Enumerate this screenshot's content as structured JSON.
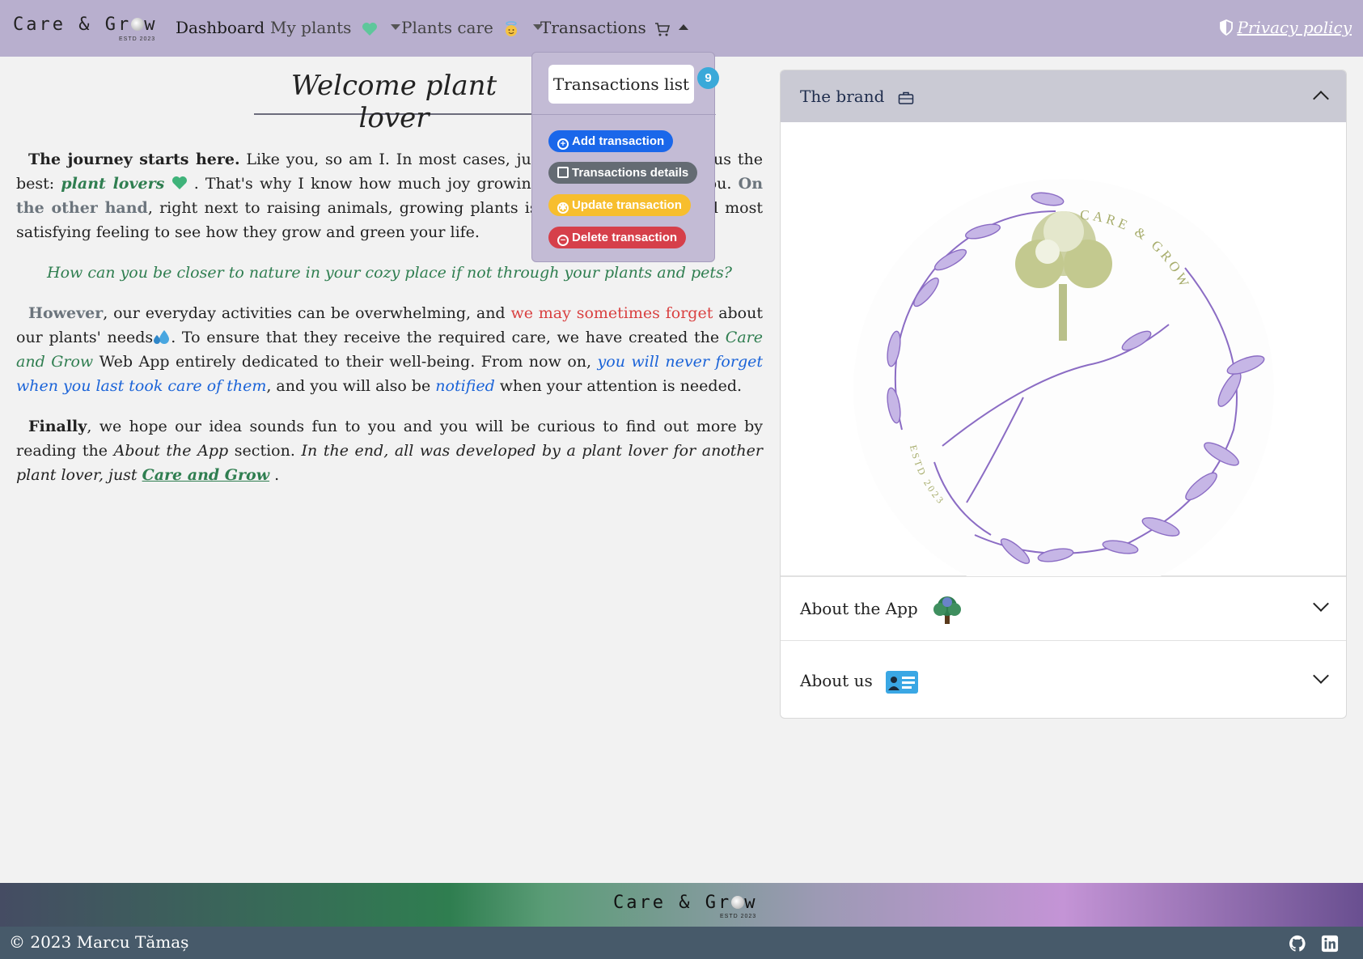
{
  "brand": {
    "name_part1": "Care & Gr",
    "name_part2": "w",
    "sub": "ESTD 2023"
  },
  "nav": {
    "dashboard": "Dashboard",
    "my_plants": "My plants",
    "plants_care": "Plants care",
    "transactions": "Transactions",
    "privacy": "Privacy policy"
  },
  "dropdown": {
    "list_label": "Transactions list",
    "badge": "9",
    "add": "Add transaction",
    "details": "Transactions details",
    "update": "Update transaction",
    "delete": "Delete transaction"
  },
  "main": {
    "welcome": "Welcome plant lover",
    "p1_bold": "The journey starts here.",
    "p1_a": " Like you, so am I. In most cases, just two words describe us the best: ",
    "p1_green": "plant lovers",
    "p1_b": " . That's why I know how much joy growing them can bring to you. ",
    "p1_grey": "On the other hand",
    "p1_c": ", right next to raising animals, growing plants is one of the purest and most satisfying feeling to see how they grow and green your life.",
    "quote": "How can you be closer to nature in your cozy place if not through your plants and pets?",
    "p2_grey": "However",
    "p2_a": ", our everyday activities can be overwhelming, and ",
    "p2_red": "we may sometimes forget",
    "p2_b": " about our plants' needs",
    "p2_c": ". To ensure that they receive the required care, we have created the ",
    "p2_green": "Care and Grow",
    "p2_d": " Web App entirely dedicated to their well-being. From now on, ",
    "p2_blue1": "you will never forget when you last took care of them",
    "p2_e": ", and you will also be ",
    "p2_blue2": "notified",
    "p2_f": " when your attention is needed.",
    "p3_bold": "Finally",
    "p3_a": ", we hope our idea sounds fun to you and you will be curious to find out more by reading the ",
    "p3_italic1": "About the App",
    "p3_b": " section. ",
    "p3_italic2": "In the end, all was developed by a plant lover for another plant lover, just ",
    "p3_link": "Care and Grow",
    "p3_c": " ."
  },
  "accordion": {
    "brand_title": "The brand",
    "app_title": "About the App",
    "us_title": "About us",
    "logo_text_top": "CARE & GROW",
    "logo_text_bottom": "ESTD 2023"
  },
  "footer": {
    "brand_part1": "Care & Gr",
    "brand_part2": "w",
    "sub": "ESTD 2023",
    "copyright": "© 2023 Marcu Tămaș"
  },
  "colors": {
    "navbar": "#b8afce",
    "accent_green": "#2f7e50",
    "primary_blue": "#1a67ea",
    "warning_yellow": "#f7be2e",
    "danger_red": "#d63f4a",
    "footer_dark": "#475a6a"
  },
  "icons": [
    "heart-icon",
    "angel-icon",
    "cart-icon",
    "shield-icon",
    "briefcase-icon",
    "tree-icon",
    "id-card-icon",
    "github-icon",
    "linkedin-icon",
    "water-drops-icon"
  ]
}
